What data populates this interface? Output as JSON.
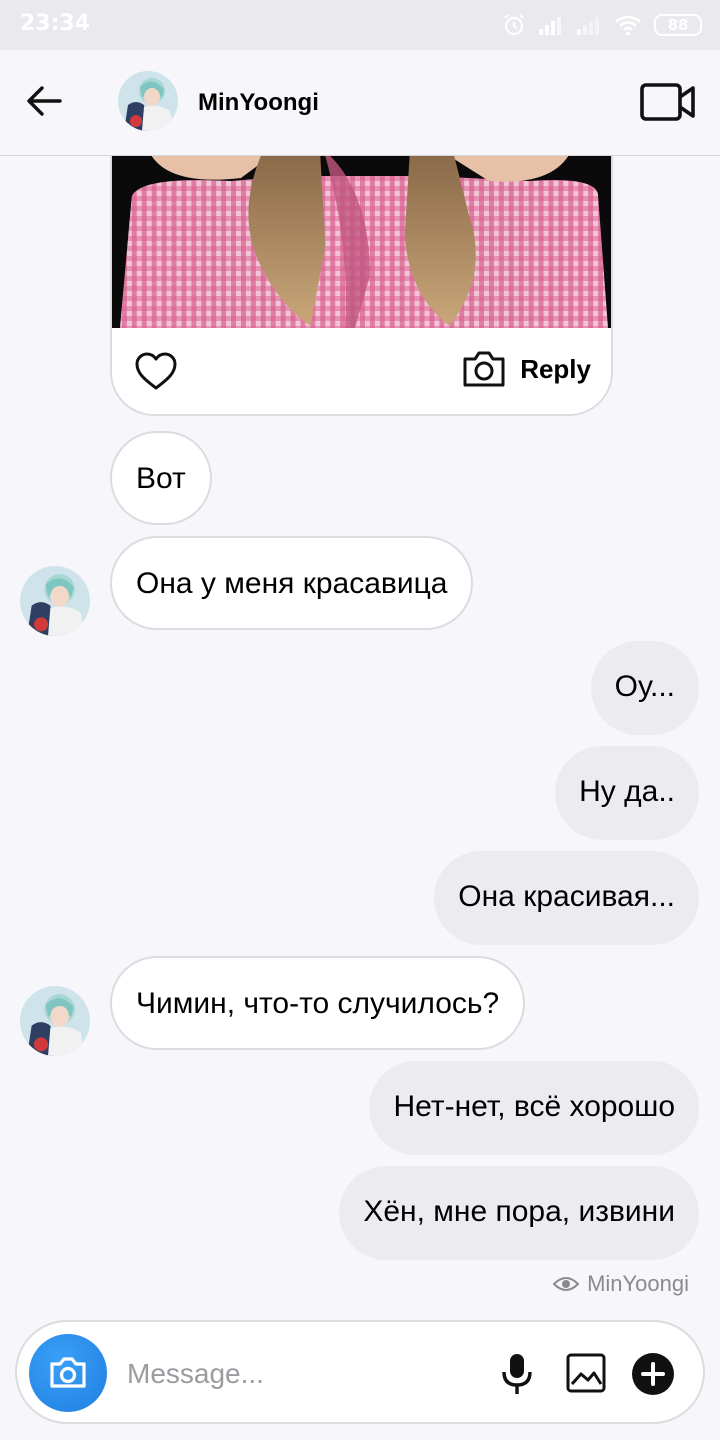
{
  "status_bar": {
    "time": "23:34",
    "battery": "88",
    "icons": [
      "alarm-icon",
      "signal-icon",
      "signal-weak-icon",
      "wifi-icon",
      "battery-icon"
    ]
  },
  "header": {
    "name": "MinYoongi",
    "icons": [
      "back-arrow-icon",
      "video-camera-icon"
    ]
  },
  "shared_post": {
    "reply_label": "Reply",
    "icons": [
      "heart-icon",
      "camera-icon"
    ]
  },
  "messages": [
    {
      "direction": "in",
      "text": "Вот"
    },
    {
      "direction": "in",
      "text": "Она у меня красавица"
    },
    {
      "direction": "out",
      "text": "Оу..."
    },
    {
      "direction": "out",
      "text": "Ну да.."
    },
    {
      "direction": "out",
      "text": "Она красивая..."
    },
    {
      "direction": "in",
      "text": "Чимин, что-то случилось?"
    },
    {
      "direction": "out",
      "text": "Нет-нет, всё хорошо"
    },
    {
      "direction": "out",
      "text": "Хён, мне пора, извини"
    }
  ],
  "seen": {
    "label": "MinYoongi",
    "icon": "eye-icon"
  },
  "composer": {
    "placeholder": "Message...",
    "icons": [
      "camera-icon",
      "microphone-icon",
      "gallery-icon",
      "plus-icon"
    ],
    "accent": "#2b8ef0"
  }
}
